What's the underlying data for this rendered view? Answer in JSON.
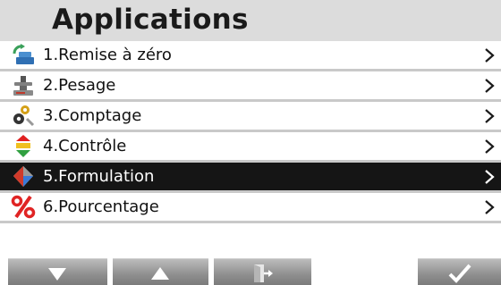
{
  "header": {
    "title": "Applications"
  },
  "menu": {
    "items": [
      {
        "label": "1.Remise à zéro",
        "icon": "tare-icon"
      },
      {
        "label": "2.Pesage",
        "icon": "weighing-icon"
      },
      {
        "label": "3.Comptage",
        "icon": "parts-counting-icon"
      },
      {
        "label": "4.Contrôle",
        "icon": "check-weighing-icon"
      },
      {
        "label": "5.Formulation",
        "icon": "formulation-icon"
      },
      {
        "label": "6.Pourcentage",
        "icon": "percent-icon"
      }
    ],
    "selected_index": 4
  },
  "toolbar": {
    "buttons": [
      {
        "icon": "arrow-down-icon"
      },
      {
        "icon": "arrow-up-icon"
      },
      {
        "icon": "exit-icon"
      },
      {
        "icon": "checkmark-icon"
      }
    ]
  },
  "colors": {
    "header_bg": "#dcdcdc",
    "selected_bg": "#151515",
    "row_divider": "#c9c9c9",
    "toolbar_button": "#8f8f8f"
  }
}
